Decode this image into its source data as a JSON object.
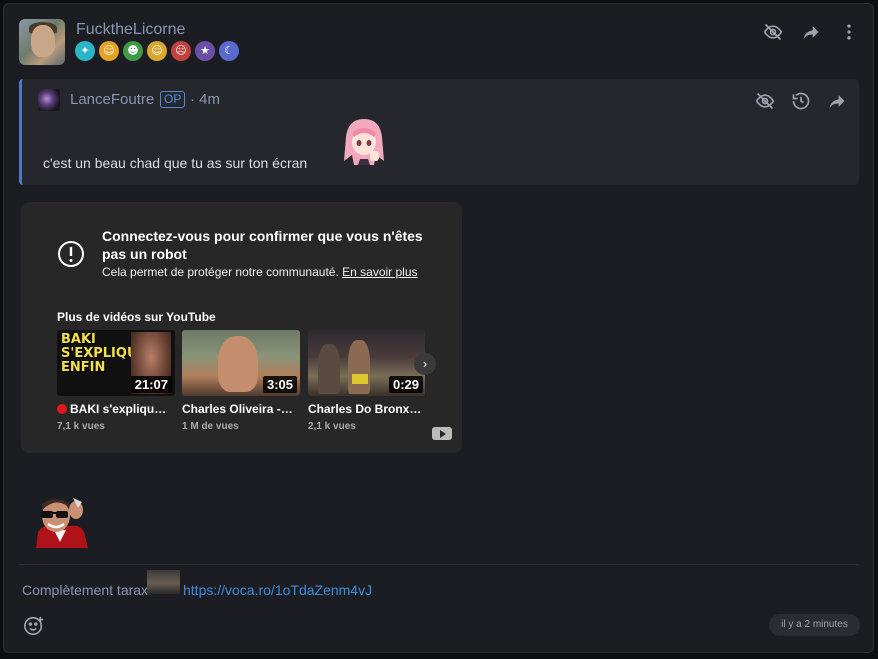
{
  "post": {
    "username": "FucktheLicorne",
    "badges": [
      {
        "icon": "diamond-badge-icon",
        "color": "#2bb5c9"
      },
      {
        "icon": "smile-badge-icon",
        "color": "#e6a427"
      },
      {
        "icon": "elf-badge-icon",
        "color": "#3f9a45"
      },
      {
        "icon": "laugh-badge-icon",
        "color": "#d9a630"
      },
      {
        "icon": "angry-badge-icon",
        "color": "#c2423f"
      },
      {
        "icon": "wizard-badge-icon",
        "color": "#6a4fa8"
      },
      {
        "icon": "moon-badge-icon",
        "color": "#5a6ad0"
      }
    ],
    "actions": [
      "hide-icon",
      "share-icon",
      "more-icon"
    ]
  },
  "quote": {
    "username": "LanceFoutre",
    "op_label": "OP",
    "time": "· 4m",
    "text": "c'est un beau chad que tu as sur ton écran",
    "actions": [
      "hide-icon",
      "history-icon",
      "share-icon"
    ]
  },
  "youtube": {
    "title": "Connectez-vous pour confirmer que vous n'êtes pas un robot",
    "subtitle": "Cela permet de protéger notre communauté.",
    "learn_more": "En savoir plus",
    "more_videos": "Plus de vidéos sur YouTube",
    "videos": [
      {
        "title": "🔴 BAKI s'explique ENFIN",
        "duration": "21:07",
        "views": "7,1 k vues",
        "thumb_text": "BAKI S'EXPLIQUE ENFIN"
      },
      {
        "title": "Charles Oliveira - Ga...",
        "duration": "3:05",
        "views": "1 M de vues"
      },
      {
        "title": "Charles Do Bronx U...",
        "duration": "0:29",
        "views": "2,1 k vues"
      }
    ]
  },
  "footer": {
    "text": "Complètement tarax",
    "link": "https://voca.ro/1oTdaZenm4vJ",
    "timestamp": "il y a 2 minutes"
  },
  "colors": {
    "accent": "#4d79c7",
    "link": "#3b8de0",
    "username": "#8b94b3"
  }
}
